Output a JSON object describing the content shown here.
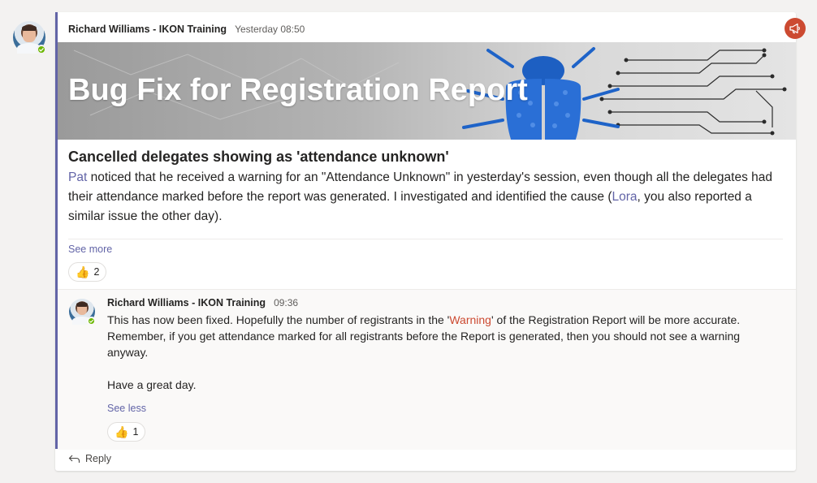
{
  "post": {
    "author": "Richard Williams - IKON Training",
    "timestamp": "Yesterday 08:50",
    "banner_title": "Bug Fix for Registration Report",
    "subject": "Cancelled delegates showing as 'attendance unknown'",
    "body": {
      "mention1": "Pat",
      "text1": " noticed that he received a warning for an \"Attendance Unknown\" in yesterday's session, even though all the delegates had their attendance marked before the report was generated. I investigated and identified the cause (",
      "mention2": "Lora",
      "text2": ", you also reported a similar issue the other day)."
    },
    "see_more_label": "See more",
    "reaction": {
      "emoji": "👍",
      "count": "2"
    },
    "announcement_icon": "megaphone-icon"
  },
  "reply": {
    "author": "Richard Williams - IKON Training",
    "timestamp": "09:36",
    "text_before": "This has now been fixed. Hopefully the number of registrants in the '",
    "highlight": "Warning",
    "text_after": "' of the Registration Report will be more accurate. Remember, if you get attendance marked for all registrants before the Report is generated, then you should not see a warning anyway.",
    "closing": "Have a great day.",
    "see_less_label": "See less",
    "reaction": {
      "emoji": "👍",
      "count": "1"
    }
  },
  "reply_button_label": "Reply",
  "colors": {
    "accent": "#6264a7",
    "announcement": "#cc4a31",
    "presence": "#6bb700",
    "warning_text": "#cc4a31"
  }
}
